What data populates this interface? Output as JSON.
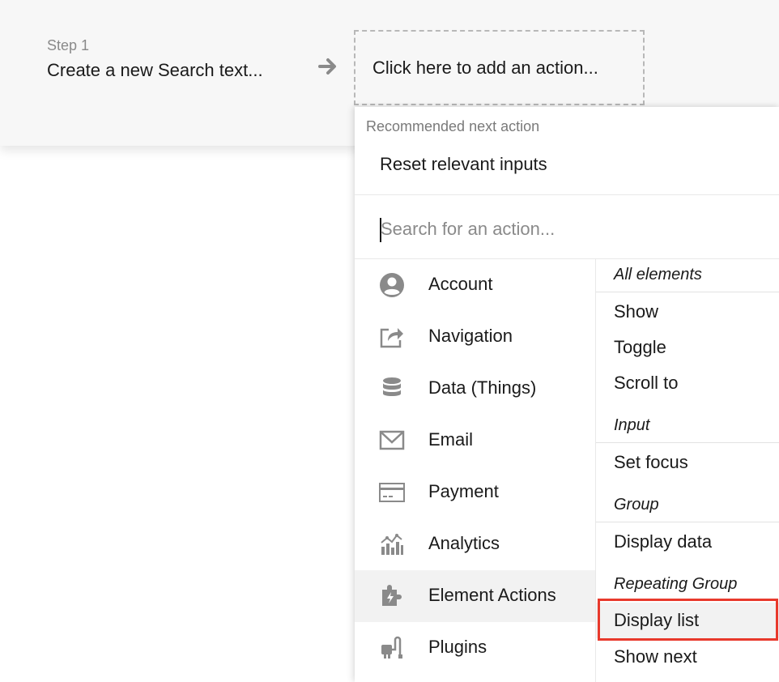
{
  "step": {
    "number_label": "Step 1",
    "title": "Create a new Search text..."
  },
  "add_action_placeholder": "Click here to add an action...",
  "dropdown": {
    "recommended_label": "Recommended next action",
    "recommended_item": "Reset relevant inputs",
    "search_placeholder": "Search for an action...",
    "categories": [
      {
        "label": "Account",
        "icon": "account-icon"
      },
      {
        "label": "Navigation",
        "icon": "navigation-icon"
      },
      {
        "label": "Data (Things)",
        "icon": "database-icon"
      },
      {
        "label": "Email",
        "icon": "email-icon"
      },
      {
        "label": "Payment",
        "icon": "credit-card-icon"
      },
      {
        "label": "Analytics",
        "icon": "analytics-icon"
      },
      {
        "label": "Element Actions",
        "icon": "element-actions-icon",
        "active": true
      },
      {
        "label": "Plugins",
        "icon": "plugin-icon"
      }
    ],
    "action_groups": {
      "all_elements": {
        "heading": "All elements",
        "items": [
          "Show",
          "Toggle",
          "Scroll to"
        ]
      },
      "input": {
        "heading": "Input",
        "items": [
          "Set focus"
        ]
      },
      "group": {
        "heading": "Group",
        "items": [
          "Display data"
        ]
      },
      "repeating_group": {
        "heading": "Repeating Group",
        "items": [
          "Display list",
          "Show next"
        ]
      }
    }
  },
  "colors": {
    "highlight_border": "#e8392c",
    "icon_gray": "#8a8a8a",
    "active_row": "#f2f2f2"
  }
}
